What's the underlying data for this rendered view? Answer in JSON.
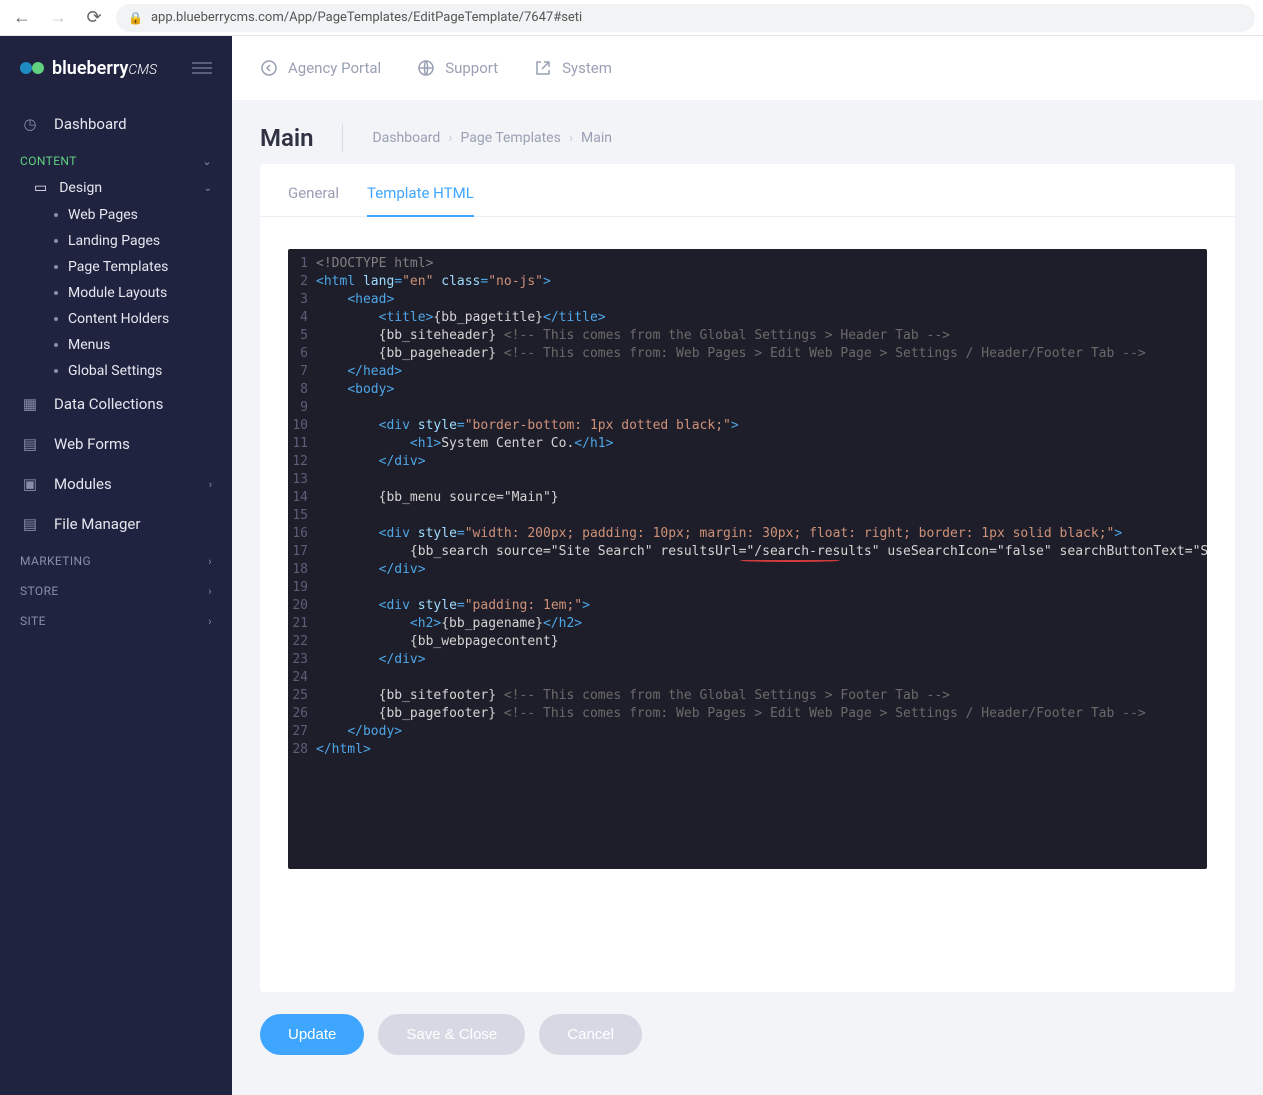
{
  "browser": {
    "url": "app.blueberrycms.com/App/PageTemplates/EditPageTemplate/7647#seti"
  },
  "brand": {
    "name": "blueberry",
    "suffix": "CMS"
  },
  "sidebar": {
    "dashboard": "Dashboard",
    "sections": {
      "content": "CONTENT",
      "marketing": "MARKETING",
      "store": "STORE",
      "site": "SITE"
    },
    "design": "Design",
    "design_children": [
      "Web Pages",
      "Landing Pages",
      "Page Templates",
      "Module Layouts",
      "Content Holders",
      "Menus",
      "Global Settings"
    ],
    "items": [
      {
        "label": "Data Collections"
      },
      {
        "label": "Web Forms"
      },
      {
        "label": "Modules"
      },
      {
        "label": "File Manager"
      }
    ]
  },
  "topbar": {
    "links": [
      "Agency Portal",
      "Support",
      "System"
    ]
  },
  "page": {
    "title": "Main",
    "crumbs": [
      "Dashboard",
      "Page Templates",
      "Main"
    ]
  },
  "tabs": {
    "general": "General",
    "template": "Template HTML"
  },
  "buttons": {
    "update": "Update",
    "saveclose": "Save & Close",
    "cancel": "Cancel"
  },
  "code": [
    {
      "n": 1,
      "indent": 0,
      "segs": [
        {
          "c": "doctype",
          "t": "<!DOCTYPE html>"
        }
      ]
    },
    {
      "n": 2,
      "indent": 0,
      "segs": [
        {
          "c": "tag",
          "t": "<html "
        },
        {
          "c": "attr",
          "t": "lang"
        },
        {
          "c": "tag",
          "t": "="
        },
        {
          "c": "str",
          "t": "\"en\""
        },
        {
          "c": "tag",
          "t": " "
        },
        {
          "c": "attr",
          "t": "class"
        },
        {
          "c": "tag",
          "t": "="
        },
        {
          "c": "str",
          "t": "\"no-js\""
        },
        {
          "c": "tag",
          "t": ">"
        }
      ]
    },
    {
      "n": 3,
      "indent": 1,
      "segs": [
        {
          "c": "tag",
          "t": "<head>"
        }
      ]
    },
    {
      "n": 4,
      "indent": 2,
      "segs": [
        {
          "c": "tag",
          "t": "<title>"
        },
        {
          "c": "txt",
          "t": "{bb_pagetitle}"
        },
        {
          "c": "tag",
          "t": "</title>"
        }
      ]
    },
    {
      "n": 5,
      "indent": 2,
      "segs": [
        {
          "c": "txt",
          "t": "{bb_siteheader} "
        },
        {
          "c": "cmt",
          "t": "<!-- This comes from the Global Settings > Header Tab -->"
        }
      ]
    },
    {
      "n": 6,
      "indent": 2,
      "segs": [
        {
          "c": "txt",
          "t": "{bb_pageheader} "
        },
        {
          "c": "cmt",
          "t": "<!-- This comes from: Web Pages > Edit Web Page > Settings / Header/Footer Tab -->"
        }
      ]
    },
    {
      "n": 7,
      "indent": 1,
      "segs": [
        {
          "c": "tag",
          "t": "</head>"
        }
      ]
    },
    {
      "n": 8,
      "indent": 1,
      "segs": [
        {
          "c": "tag",
          "t": "<body>"
        }
      ]
    },
    {
      "n": 9,
      "indent": 0,
      "segs": []
    },
    {
      "n": 10,
      "indent": 2,
      "segs": [
        {
          "c": "tag",
          "t": "<div "
        },
        {
          "c": "attr",
          "t": "style"
        },
        {
          "c": "tag",
          "t": "="
        },
        {
          "c": "str",
          "t": "\"border-bottom: 1px dotted black;\""
        },
        {
          "c": "tag",
          "t": ">"
        }
      ]
    },
    {
      "n": 11,
      "indent": 3,
      "segs": [
        {
          "c": "tag",
          "t": "<h1>"
        },
        {
          "c": "txt",
          "t": "System Center Co."
        },
        {
          "c": "tag",
          "t": "</h1>"
        }
      ]
    },
    {
      "n": 12,
      "indent": 2,
      "segs": [
        {
          "c": "tag",
          "t": "</div>"
        }
      ]
    },
    {
      "n": 13,
      "indent": 0,
      "segs": []
    },
    {
      "n": 14,
      "indent": 2,
      "segs": [
        {
          "c": "txt",
          "t": "{bb_menu source=\"Main\"}"
        }
      ]
    },
    {
      "n": 15,
      "indent": 0,
      "segs": []
    },
    {
      "n": 16,
      "indent": 2,
      "segs": [
        {
          "c": "tag",
          "t": "<div "
        },
        {
          "c": "attr",
          "t": "style"
        },
        {
          "c": "tag",
          "t": "="
        },
        {
          "c": "str",
          "t": "\"width: 200px; padding: 10px; margin: 30px; float: right; border: 1px solid black;\""
        },
        {
          "c": "tag",
          "t": ">"
        }
      ]
    },
    {
      "n": 17,
      "indent": 3,
      "segs": [
        {
          "c": "txt",
          "t": "{bb_search source=\"Site Search\" resultsUrl=\"/search-results\" useSearchIcon=\"false\" searchButtonText=\"Search\"}"
        }
      ]
    },
    {
      "n": 18,
      "indent": 2,
      "segs": [
        {
          "c": "tag",
          "t": "</div>"
        }
      ]
    },
    {
      "n": 19,
      "indent": 0,
      "segs": []
    },
    {
      "n": 20,
      "indent": 2,
      "segs": [
        {
          "c": "tag",
          "t": "<div "
        },
        {
          "c": "attr",
          "t": "style"
        },
        {
          "c": "tag",
          "t": "="
        },
        {
          "c": "str",
          "t": "\"padding: 1em;\""
        },
        {
          "c": "tag",
          "t": ">"
        }
      ]
    },
    {
      "n": 21,
      "indent": 3,
      "segs": [
        {
          "c": "tag",
          "t": "<h2>"
        },
        {
          "c": "txt",
          "t": "{bb_pagename}"
        },
        {
          "c": "tag",
          "t": "</h2>"
        }
      ]
    },
    {
      "n": 22,
      "indent": 3,
      "segs": [
        {
          "c": "txt",
          "t": "{bb_webpagecontent}"
        }
      ]
    },
    {
      "n": 23,
      "indent": 2,
      "segs": [
        {
          "c": "tag",
          "t": "</div>"
        }
      ]
    },
    {
      "n": 24,
      "indent": 0,
      "segs": []
    },
    {
      "n": 25,
      "indent": 2,
      "segs": [
        {
          "c": "txt",
          "t": "{bb_sitefooter} "
        },
        {
          "c": "cmt",
          "t": "<!-- This comes from the Global Settings > Footer Tab -->"
        }
      ]
    },
    {
      "n": 26,
      "indent": 2,
      "segs": [
        {
          "c": "txt",
          "t": "{bb_pagefooter} "
        },
        {
          "c": "cmt",
          "t": "<!-- This comes from: Web Pages > Edit Web Page > Settings / Header/Footer Tab -->"
        }
      ]
    },
    {
      "n": 27,
      "indent": 1,
      "segs": [
        {
          "c": "tag",
          "t": "</body>"
        }
      ]
    },
    {
      "n": 28,
      "indent": 0,
      "segs": [
        {
          "c": "tag",
          "t": "</html>"
        }
      ]
    }
  ]
}
